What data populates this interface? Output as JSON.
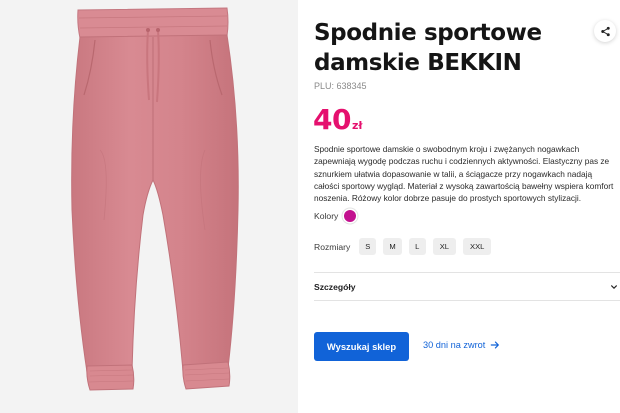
{
  "product": {
    "title": "Spodnie sportowe damskie BEKKIN",
    "plu": "PLU: 638345",
    "price": {
      "amount": "40",
      "currency": "zł",
      "color": "#e5106e"
    },
    "description": "Spodnie sportowe damskie o swobodnym kroju i zwężanych nogawkach zapewniają wygodę podczas ruchu i codziennych aktywności. Elastyczny pas ze sznurkiem ułatwia dopasowanie w talii, a ściągacze przy nogawkach nadają całości sportowy wygląd. Materiał z wysoką zawartością bawełny wspiera komfort noszenia. Różowy kolor dobrze pasuje do prostych sportowych stylizacji.",
    "image": {
      "icon": "pink-sweatpants-photo",
      "garment_color": "#d4848c"
    }
  },
  "colors": {
    "label": "Kolory",
    "options": [
      {
        "name": "pink",
        "hex": "#c3118f"
      }
    ]
  },
  "sizes": {
    "label": "Rozmiary",
    "options": [
      "S",
      "M",
      "L",
      "XL",
      "XXL"
    ]
  },
  "details": {
    "label": "Szczegóły",
    "icon": "chevron-down-icon"
  },
  "actions": {
    "find_store": "Wyszukaj sklep",
    "returns": "30 dni na zwrot",
    "returns_icon": "arrow-right-icon",
    "share_icon": "share-icon",
    "accent": "#1163d8"
  }
}
